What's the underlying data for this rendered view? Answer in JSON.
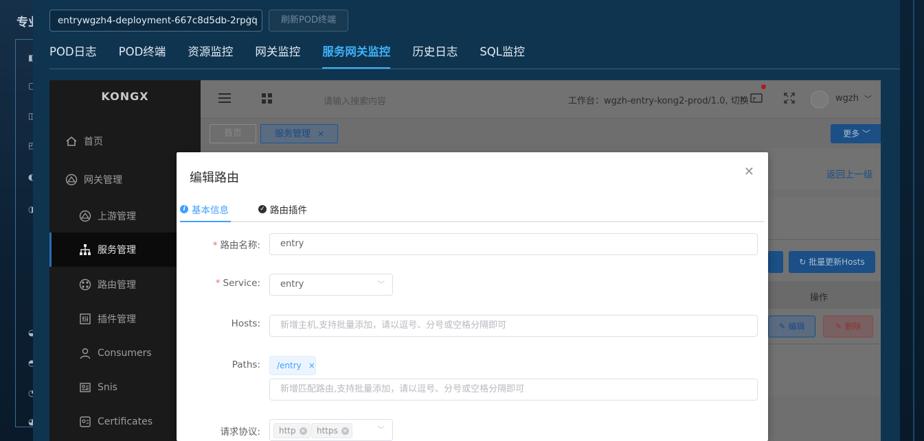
{
  "background": {
    "left_title": "专业"
  },
  "pod_window": {
    "pod_selector": "entrywgzh4-deployment-667c8d5db-2rpgq",
    "refresh_button": "刷新POD终端",
    "tabs": [
      {
        "label": "POD日志",
        "active": false
      },
      {
        "label": "POD终端",
        "active": false
      },
      {
        "label": "资源监控",
        "active": false
      },
      {
        "label": "网关监控",
        "active": false
      },
      {
        "label": "服务网关监控",
        "active": true
      },
      {
        "label": "历史日志",
        "active": false
      },
      {
        "label": "SQL监控",
        "active": false
      }
    ]
  },
  "app": {
    "logo": "KONGX",
    "sidebar": {
      "items": [
        {
          "label": "首页",
          "icon": "home-icon"
        },
        {
          "label": "网关管理",
          "icon": "gateway-icon"
        },
        {
          "label": "上游管理",
          "icon": "upstream-icon"
        },
        {
          "label": "服务管理",
          "icon": "service-tree-icon",
          "active": true
        },
        {
          "label": "路由管理",
          "icon": "route-icon"
        },
        {
          "label": "插件管理",
          "icon": "plugin-icon"
        },
        {
          "label": "Consumers",
          "icon": "user-icon"
        },
        {
          "label": "Snis",
          "icon": "sni-icon"
        },
        {
          "label": "Certificates",
          "icon": "certificate-icon"
        }
      ]
    },
    "topbar": {
      "search_placeholder": "请输入搜索内容",
      "workspace": "工作台：wgzh-entry-kong2-prod/1.0, 切换",
      "username": "wgzh"
    },
    "tags": {
      "home": "首页",
      "service": "服务管理",
      "more": "更多"
    },
    "back_link": "返回上一级",
    "batch_update_button": "批量更新Hosts",
    "table_header_operation": "操作",
    "edit_button": "编辑",
    "delete_button": "删除"
  },
  "modal": {
    "title": "编辑路由",
    "tabs": [
      {
        "label": "基本信息",
        "active": true
      },
      {
        "label": "路由插件",
        "active": false
      }
    ],
    "fields": {
      "route_name": {
        "label": "路由名称:",
        "value": "entry",
        "required": true
      },
      "service": {
        "label": "Service:",
        "value": "entry",
        "required": true
      },
      "hosts": {
        "label": "Hosts:",
        "placeholder": "新增主机,支持批量添加，请以逗号、分号或空格分隔即可"
      },
      "paths": {
        "label": "Paths:",
        "tags": [
          "/entry"
        ],
        "placeholder": "新增匹配路由,支持批量添加，请以逗号、分号或空格分隔即可"
      },
      "protocols": {
        "label": "请求协议:",
        "tags": [
          "http",
          "https"
        ]
      }
    }
  },
  "colors": {
    "accent": "#409eff",
    "pod_tab_active": "#3db2f7",
    "required": "#f56c6c"
  }
}
